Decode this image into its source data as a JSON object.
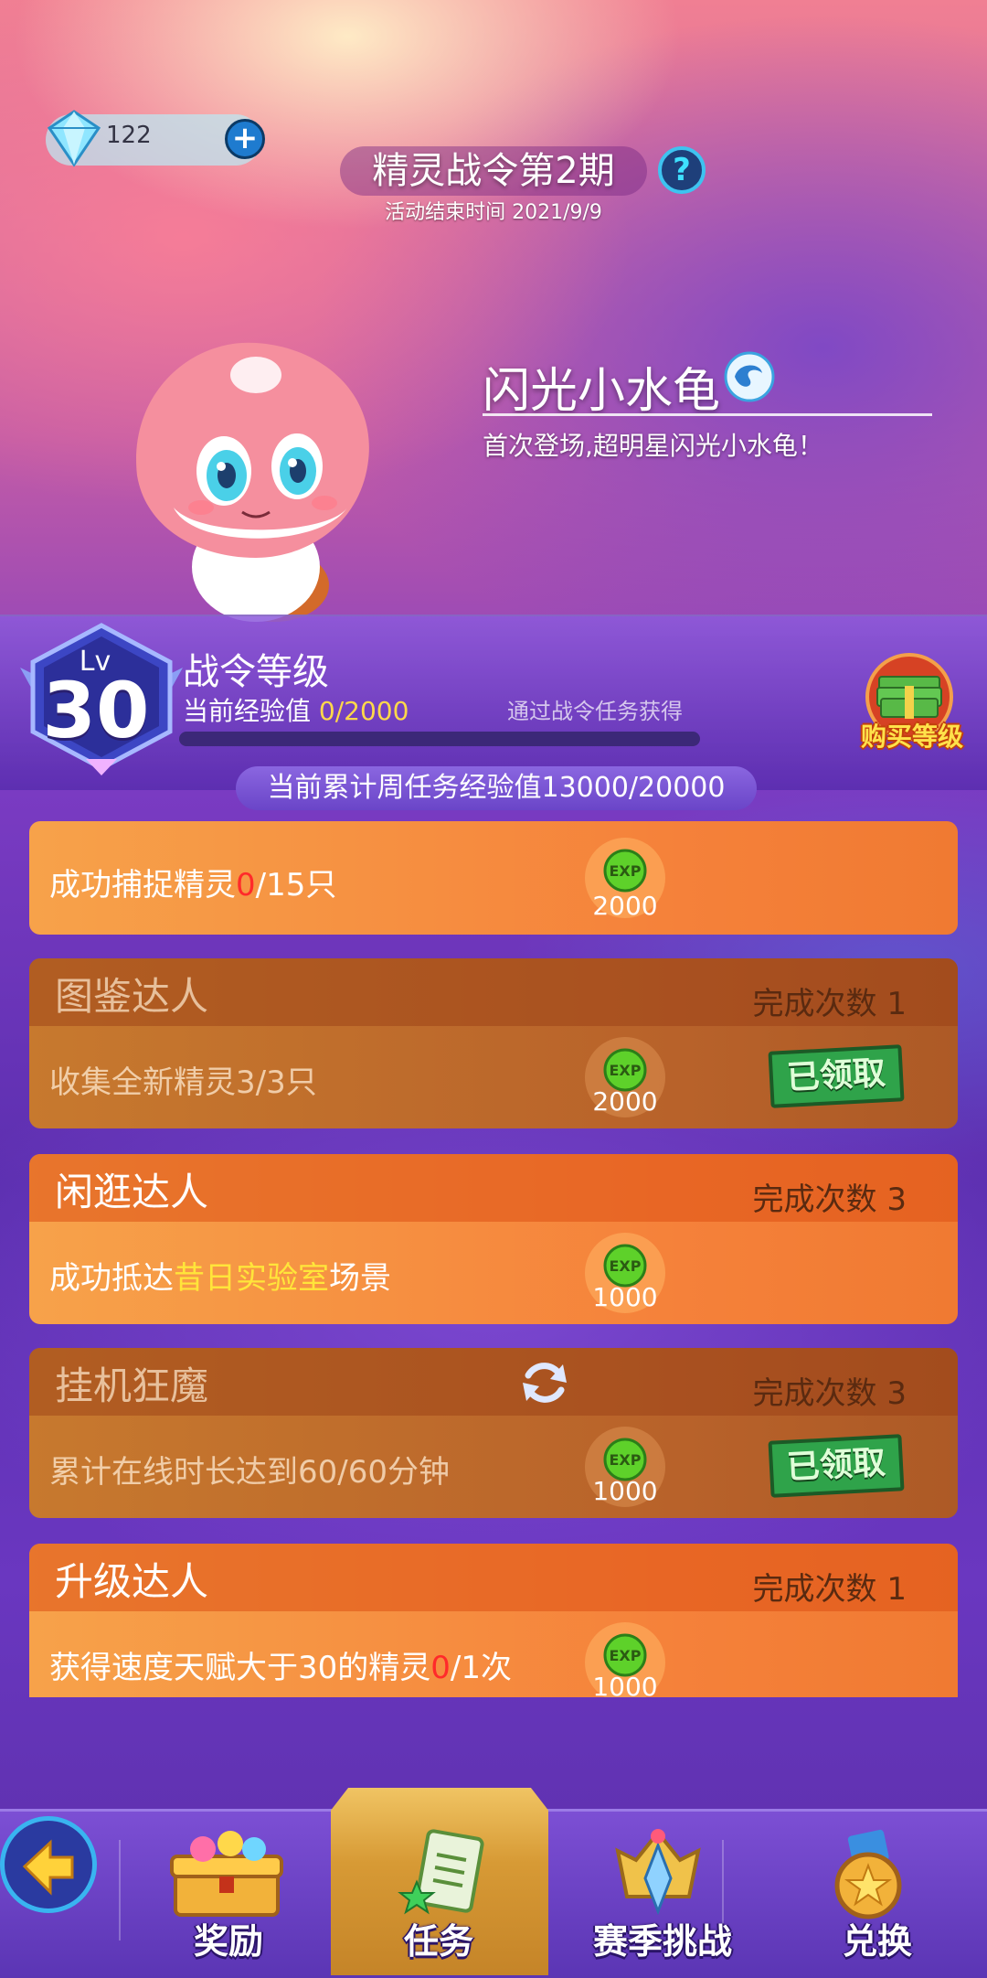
{
  "header": {
    "gem_count": "122",
    "plus_label": "+",
    "title": "精灵战令第2期",
    "subtitle": "活动结束时间 2021/9/9",
    "help_label": "?"
  },
  "featured": {
    "pet_name": "闪光小水龟",
    "pet_desc": "首次登场,超明星闪光小水龟！"
  },
  "level": {
    "lv_label": "Lv",
    "lv_value": "30",
    "title": "战令等级",
    "exp_label": "当前经验值",
    "exp_value": "0/2000",
    "exp_progress": 0,
    "exp_hint": "通过战令任务获得",
    "buy_label": "购买等级",
    "weekly_exp": "当前累计周任务经验值13000/20000"
  },
  "tasks": [
    {
      "desc_a": "成功捕捉精灵",
      "desc_b": "0",
      "desc_c": "/15只",
      "exp": "2000"
    },
    {
      "name": "图鉴达人",
      "count": "完成次数 1",
      "desc": "收集全新精灵3/3只",
      "exp": "2000",
      "status": "已领取"
    },
    {
      "name": "闲逛达人",
      "count": "完成次数 3",
      "desc_a": "成功抵达",
      "desc_b": "昔日实验室",
      "desc_c": "场景",
      "exp": "1000"
    },
    {
      "name": "挂机狂魔",
      "count": "完成次数 3",
      "desc": "累计在线时长达到60/60分钟",
      "exp": "1000",
      "status": "已领取"
    },
    {
      "name": "升级达人",
      "count": "完成次数 1",
      "desc_a": "获得速度天赋大于30的精灵",
      "desc_b": "0",
      "desc_c": "/1次",
      "exp": "1000"
    }
  ],
  "exp_icon_text": "EXP",
  "nav": {
    "items": [
      "奖励",
      "任务",
      "赛季挑战",
      "兑换"
    ],
    "active": "任务"
  },
  "colors": {
    "task_orange": "#f5813a",
    "task_done": "#b8622a",
    "nav_purple": "#6a42c4",
    "nav_active_gold": "#d79a35"
  }
}
